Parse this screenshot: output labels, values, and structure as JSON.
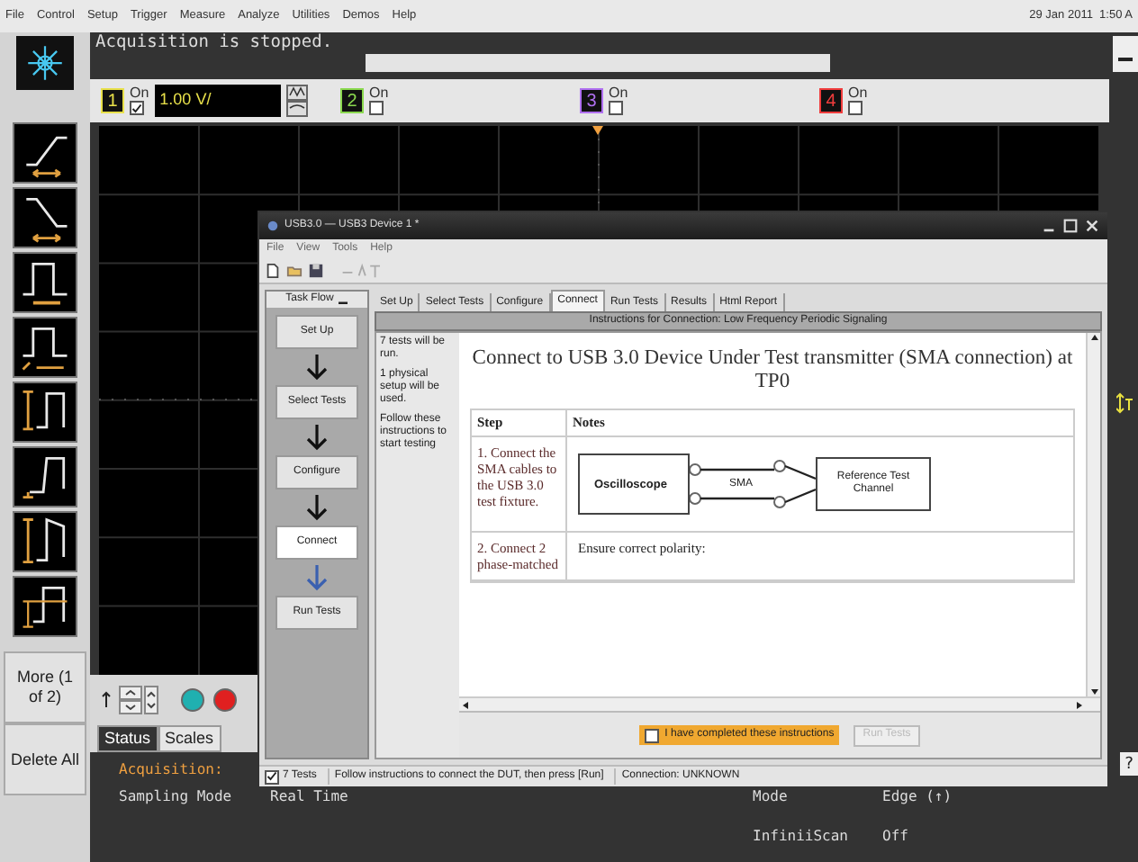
{
  "menu_bar": {
    "items": [
      "File",
      "Control",
      "Setup",
      "Trigger",
      "Measure",
      "Analyze",
      "Utilities",
      "Demos",
      "Help"
    ],
    "datetime": "29 Jan 2011  1:50 A"
  },
  "status_message": "Acquisition is stopped.",
  "channels": [
    {
      "label": "1",
      "on_label": "On",
      "on": true,
      "color": "#e8e04a",
      "scale": "1.00 V/"
    },
    {
      "label": "2",
      "on_label": "On",
      "on": false,
      "color": "#8ad84e"
    },
    {
      "label": "3",
      "on_label": "On",
      "on": false,
      "color": "#b070f0"
    },
    {
      "label": "4",
      "on_label": "On",
      "on": false,
      "color": "#f03c3c"
    }
  ],
  "side_buttons": [
    "More (1 of 2)",
    "Delete All"
  ],
  "panel_tabs": [
    {
      "label": "Status",
      "selected": true
    },
    {
      "label": "Scales",
      "selected": false
    }
  ],
  "status": {
    "heading": "Acquisition:",
    "fields": [
      {
        "label": "Sampling Mode",
        "value": "Real Time"
      },
      {
        "label": "Mode",
        "value": "Edge (↑)"
      },
      {
        "label": "InfiniiScan",
        "value": "Off"
      }
    ]
  },
  "help_button": "?",
  "dialog": {
    "title": "USB3.0 — USB3 Device 1 *",
    "menu": [
      "File",
      "View",
      "Tools",
      "Help"
    ],
    "task_flow": {
      "title": "Task Flow",
      "steps": [
        {
          "label": "Set Up",
          "selected": false
        },
        {
          "label": "Select Tests",
          "selected": false
        },
        {
          "label": "Configure",
          "selected": false
        },
        {
          "label": "Connect",
          "selected": true
        },
        {
          "label": "Run Tests",
          "selected": false
        }
      ]
    },
    "tabs": [
      {
        "label": "Set Up",
        "selected": false
      },
      {
        "label": "Select Tests",
        "selected": false
      },
      {
        "label": "Configure",
        "selected": false
      },
      {
        "label": "Connect",
        "selected": true
      },
      {
        "label": "Run Tests",
        "selected": false
      },
      {
        "label": "Results",
        "selected": false
      },
      {
        "label": "Html Report",
        "selected": false
      }
    ],
    "header": "Instructions for Connection: Low Frequency Periodic Signaling",
    "info": [
      "7 tests will be run.",
      "1 physical setup will be used.",
      "Follow these instructions to start testing"
    ],
    "heading": "Connect to USB 3.0 Device Under Test transmitter (SMA connection) at TP0",
    "table": {
      "columns": [
        "Step",
        "Notes"
      ],
      "rows": [
        {
          "kind": "diagram",
          "step": "1. Connect the SMA cables to the USB 3.0 test fixture.",
          "diagram": {
            "left": "Oscilloscope",
            "cable": "SMA",
            "right": "Reference Test Channel"
          }
        },
        {
          "kind": "text",
          "step": "2. Connect 2 phase-matched",
          "note": "Ensure correct polarity:"
        }
      ]
    },
    "confirm": {
      "label": "I have completed these instructions",
      "checked": false
    },
    "run_button": {
      "label": "Run Tests",
      "disabled": true
    },
    "status_bar": {
      "tests": {
        "label": "7 Tests",
        "checked": true
      },
      "message": "Follow instructions to connect the DUT, then press [Run]",
      "connection": "Connection: UNKNOWN"
    }
  }
}
